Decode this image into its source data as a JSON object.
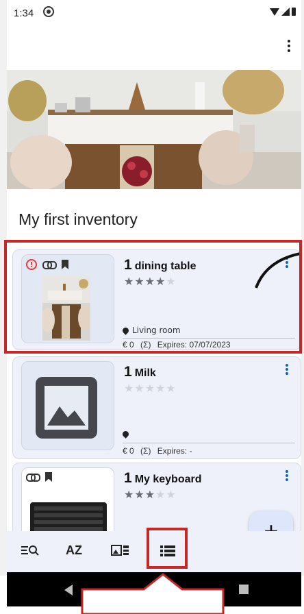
{
  "status_bar": {
    "time": "1:34"
  },
  "inventory_title": "My first inventory",
  "items": [
    {
      "quantity": "1",
      "name": "dining table",
      "rating": 4,
      "location": "Living room",
      "price": "€ 0",
      "sum_symbol": "(Σ)",
      "expires": "Expires: 07/07/2023",
      "has_alert": true,
      "linked": true,
      "bookmarked": true
    },
    {
      "quantity": "1",
      "name": "Milk",
      "rating": 0,
      "location": "",
      "price": "€ 0",
      "sum_symbol": "(Σ)",
      "expires": "Expires: -",
      "has_alert": false,
      "linked": false,
      "bookmarked": false
    },
    {
      "quantity": "1",
      "name": "My keyboard",
      "rating": 3,
      "linked": true,
      "bookmarked": true
    }
  ],
  "fab_label": "+",
  "bottom_nav": {
    "az_label": "AZ"
  },
  "colors": {
    "accent": "#1565c0",
    "highlight": "#c62828",
    "card_bg": "#eef1fa",
    "alert": "#e53935"
  }
}
